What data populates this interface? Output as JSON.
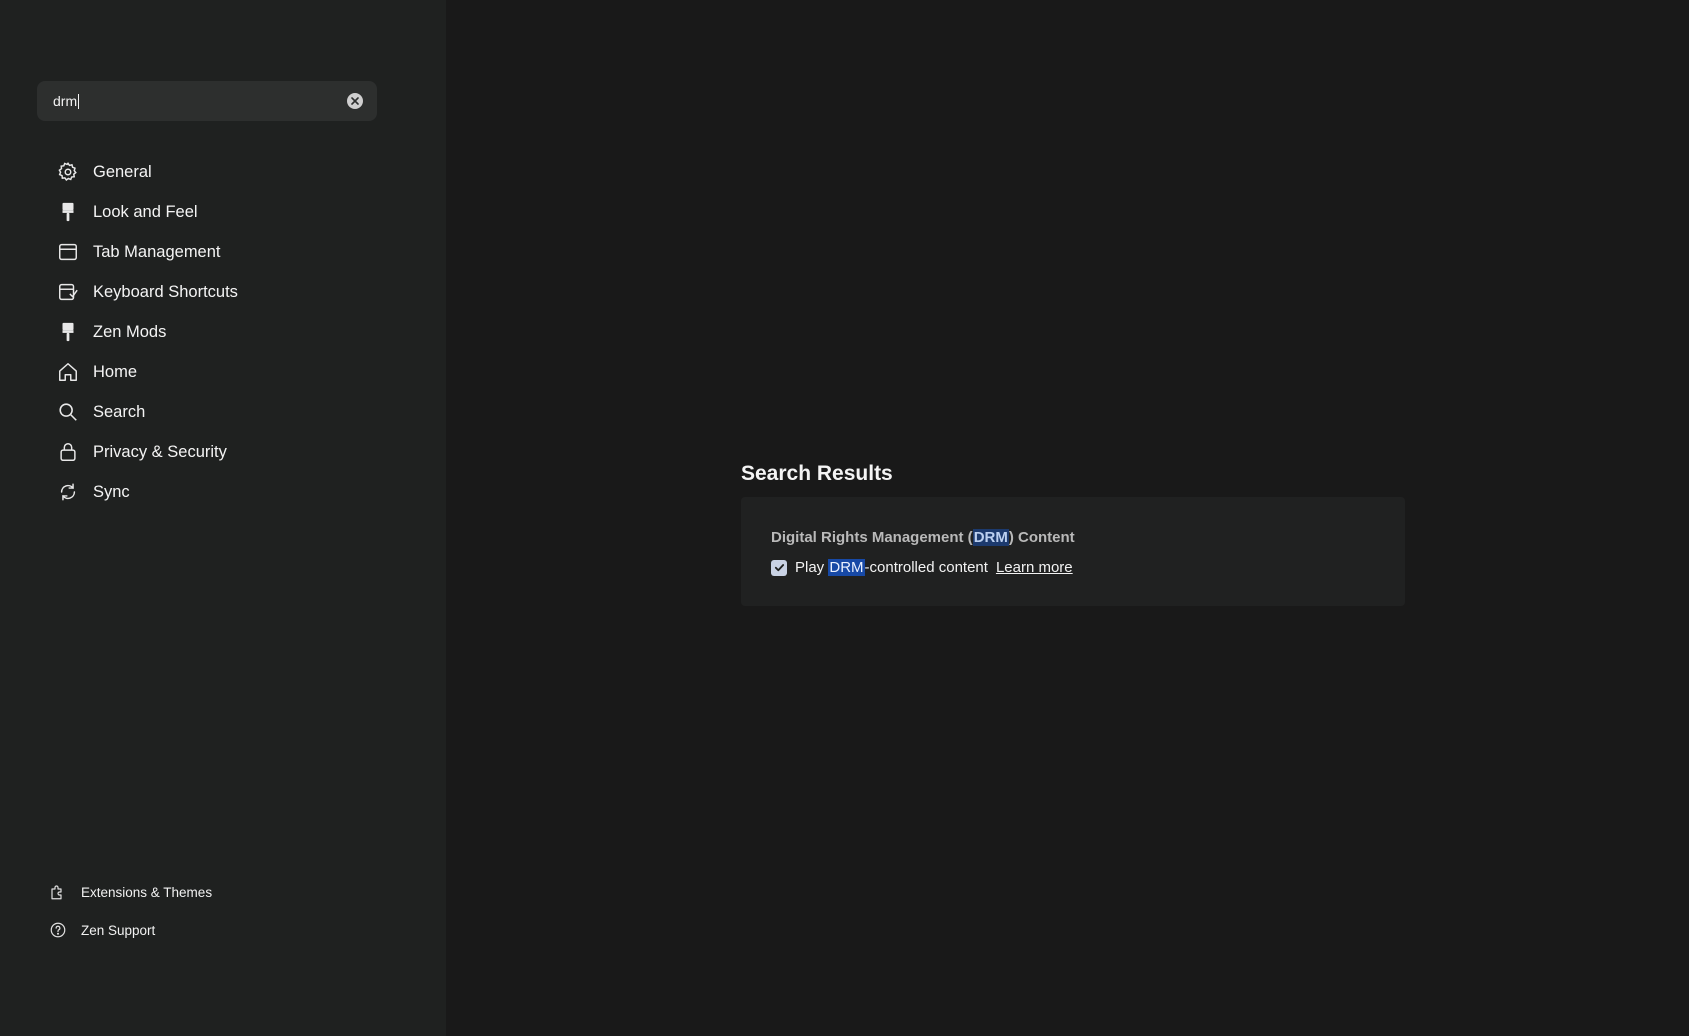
{
  "sidebar": {
    "search": {
      "value": "drm"
    },
    "items": [
      {
        "label": "General",
        "icon": "gear-icon"
      },
      {
        "label": "Look and Feel",
        "icon": "paint-brush-icon"
      },
      {
        "label": "Tab Management",
        "icon": "window-icon"
      },
      {
        "label": "Keyboard Shortcuts",
        "icon": "keyboard-shortcut-icon"
      },
      {
        "label": "Zen Mods",
        "icon": "paint-brush-icon"
      },
      {
        "label": "Home",
        "icon": "home-icon"
      },
      {
        "label": "Search",
        "icon": "search-icon"
      },
      {
        "label": "Privacy & Security",
        "icon": "lock-icon"
      },
      {
        "label": "Sync",
        "icon": "sync-icon"
      }
    ],
    "bottom_items": [
      {
        "label": "Extensions & Themes",
        "icon": "puzzle-icon"
      },
      {
        "label": "Zen Support",
        "icon": "help-icon"
      }
    ]
  },
  "main": {
    "title": "Search Results",
    "group": {
      "heading_pre": "Digital Rights Management (",
      "heading_match": "DRM",
      "heading_post": ") Content",
      "option": {
        "checked": true,
        "label_pre": "Play ",
        "label_match": "DRM",
        "label_post": "-controlled content",
        "link": "Learn more"
      }
    }
  },
  "colors": {
    "sidebar_bg": "#1f2120",
    "main_bg": "#191919",
    "card_bg": "#202121",
    "highlight": "#1749a6"
  }
}
